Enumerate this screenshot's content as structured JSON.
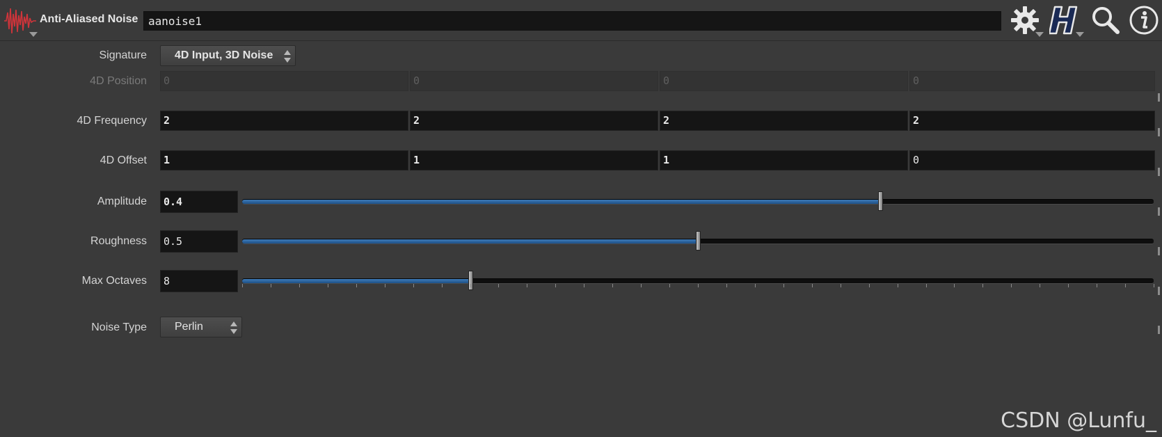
{
  "header": {
    "node_type": "Anti-Aliased Noise",
    "node_name": "aanoise1",
    "icons": {
      "node": "noise-waveform-icon",
      "gear": "gear-icon",
      "help": "houdini-h-icon",
      "search": "search-icon",
      "info": "info-icon"
    }
  },
  "params": {
    "signature": {
      "label": "Signature",
      "value": "4D Input, 3D Noise"
    },
    "position": {
      "label": "4D Position",
      "values": [
        "0",
        "0",
        "0",
        "0"
      ]
    },
    "frequency": {
      "label": "4D Frequency",
      "values": [
        "2",
        "2",
        "2",
        "2"
      ]
    },
    "offset": {
      "label": "4D Offset",
      "values": [
        "1",
        "1",
        "1",
        "0"
      ]
    },
    "amplitude": {
      "label": "Amplitude",
      "value": "0.4",
      "slider_fraction": 0.7
    },
    "roughness": {
      "label": "Roughness",
      "value": "0.5",
      "slider_fraction": 0.5
    },
    "max_octaves": {
      "label": "Max Octaves",
      "value": "8",
      "slider_fraction": 0.25
    },
    "noise_type": {
      "label": "Noise Type",
      "value": "Perlin"
    }
  },
  "watermark": "CSDN @Lunfu_",
  "colors": {
    "background": "#3a3a3a",
    "field": "#151515",
    "slider_fill": "#2f6aa8",
    "node_icon": "#d0343a"
  }
}
